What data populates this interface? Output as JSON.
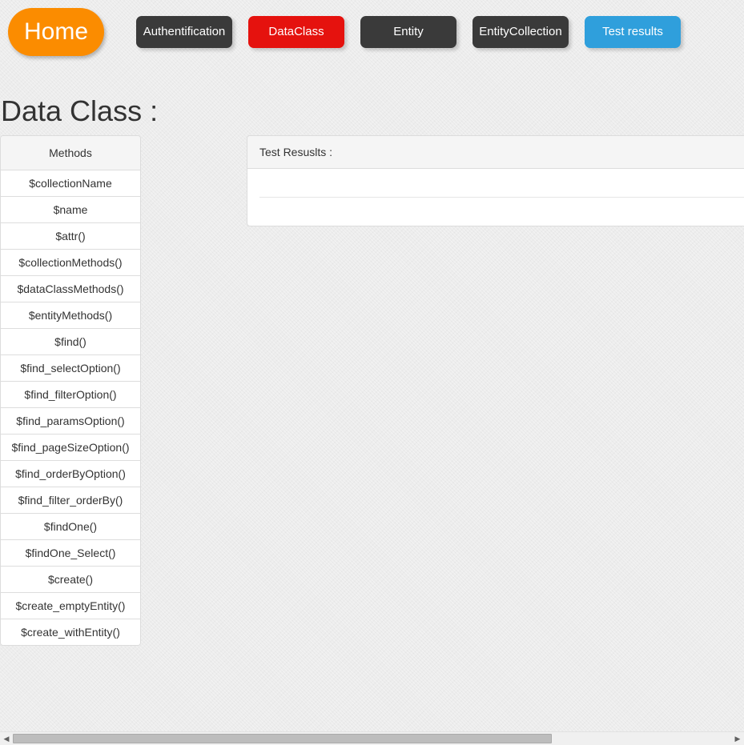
{
  "nav": {
    "home": {
      "label": "Home",
      "color": "#fb8c00"
    },
    "buttons": [
      {
        "label": "Authentification",
        "color": "#3a3a3a"
      },
      {
        "label": "DataClass",
        "color": "#e5120e"
      },
      {
        "label": "Entity",
        "color": "#3a3a3a"
      },
      {
        "label": "EntityCollection",
        "color": "#3a3a3a"
      },
      {
        "label": "Test results",
        "color": "#2f9fdc"
      }
    ]
  },
  "page": {
    "title": "Data Class :"
  },
  "methods": {
    "header": "Methods",
    "items": [
      "$collectionName",
      "$name",
      "$attr()",
      "$collectionMethods()",
      "$dataClassMethods()",
      "$entityMethods()",
      "$find()",
      "$find_selectOption()",
      "$find_filterOption()",
      "$find_paramsOption()",
      "$find_pageSizeOption()",
      "$find_orderByOption()",
      "$find_filter_orderBy()",
      "$findOne()",
      "$findOne_Select()",
      "$create()",
      "$create_emptyEntity()",
      "$create_withEntity()"
    ]
  },
  "results": {
    "header": "Test Resuslts :"
  },
  "scrollbar": {
    "left_arrow_icon": "triangle-left-icon",
    "right_arrow_icon": "triangle-right-icon",
    "position": 0.0,
    "visible_fraction": 0.75
  }
}
